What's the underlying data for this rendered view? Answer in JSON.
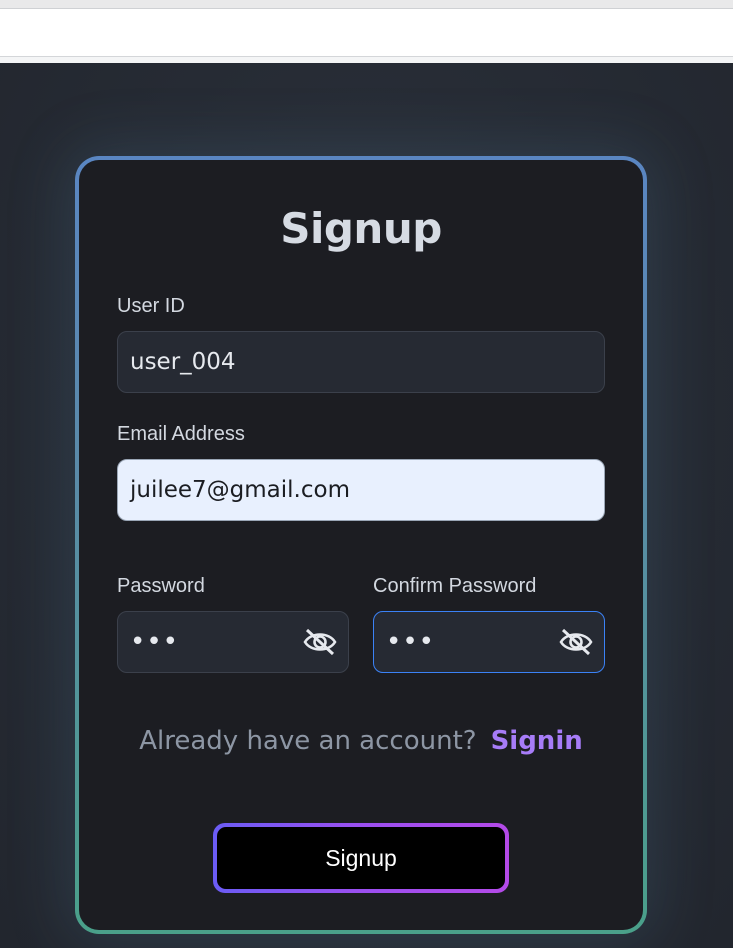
{
  "form": {
    "title": "Signup",
    "user_id": {
      "label": "User ID",
      "value": "user_004"
    },
    "email": {
      "label": "Email Address",
      "value": "juilee7@gmail.com"
    },
    "password": {
      "label": "Password",
      "masked_value": "•••",
      "toggle_icon": "eye-off-icon"
    },
    "confirm_password": {
      "label": "Confirm Password",
      "masked_value": "•••",
      "toggle_icon": "eye-off-icon"
    },
    "signin_prompt": "Already have an account?",
    "signin_link": "Signin",
    "submit_label": "Signup"
  },
  "colors": {
    "page_background": "#252a33",
    "card_background": "#1c1d22",
    "card_border_top": "#5a86c2",
    "card_border_bottom": "#4aa08a",
    "link": "#a77cf8",
    "button_border_start": "#6b5cf5",
    "button_border_end": "#b44ae8",
    "focus_border": "#3b82f6"
  }
}
